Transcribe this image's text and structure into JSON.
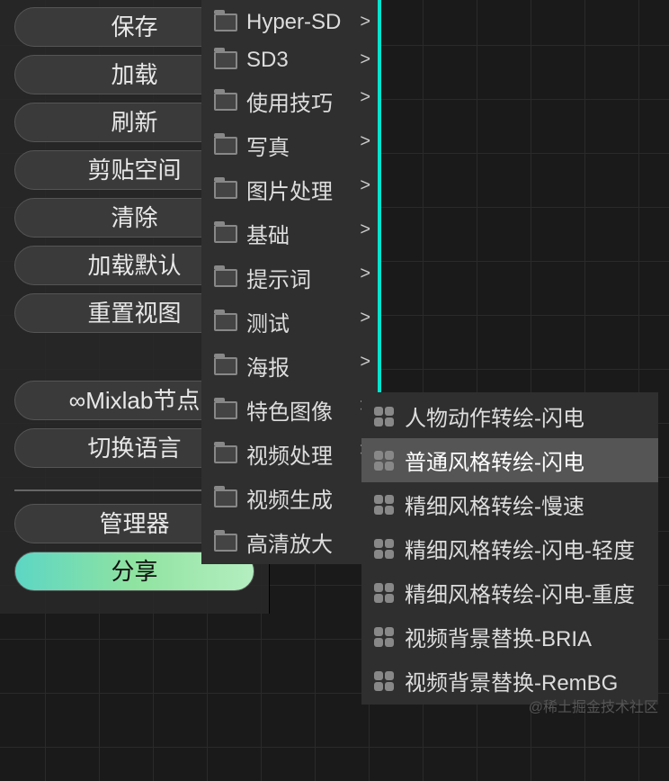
{
  "panel": {
    "buttons1": [
      "保存",
      "加载",
      "刷新",
      "剪贴空间",
      "清除",
      "加载默认",
      "重置视图"
    ],
    "buttons2": [
      "∞Mixlab节点",
      "切换语言"
    ],
    "buttons3": [
      "管理器",
      "分享"
    ]
  },
  "menu1": {
    "items": [
      {
        "label": "Hyper-SD",
        "sub": true
      },
      {
        "label": "SD3",
        "sub": true
      },
      {
        "label": "使用技巧",
        "sub": true
      },
      {
        "label": "写真",
        "sub": true
      },
      {
        "label": "图片处理",
        "sub": true
      },
      {
        "label": "基础",
        "sub": true
      },
      {
        "label": "提示词",
        "sub": true
      },
      {
        "label": "测试",
        "sub": true
      },
      {
        "label": "海报",
        "sub": true
      },
      {
        "label": "特色图像",
        "sub": true
      },
      {
        "label": "视频处理",
        "sub": true
      },
      {
        "label": "视频生成",
        "sub": false
      },
      {
        "label": "高清放大",
        "sub": false
      }
    ]
  },
  "menu2": {
    "items": [
      {
        "label": "人物动作转绘-闪电",
        "hover": false
      },
      {
        "label": "普通风格转绘-闪电",
        "hover": true
      },
      {
        "label": "精细风格转绘-慢速",
        "hover": false
      },
      {
        "label": "精细风格转绘-闪电-轻度",
        "hover": false
      },
      {
        "label": "精细风格转绘-闪电-重度",
        "hover": false
      },
      {
        "label": "视频背景替换-BRIA",
        "hover": false
      },
      {
        "label": "视频背景替换-RemBG",
        "hover": false
      }
    ]
  },
  "watermark": "@稀土掘金技术社区"
}
